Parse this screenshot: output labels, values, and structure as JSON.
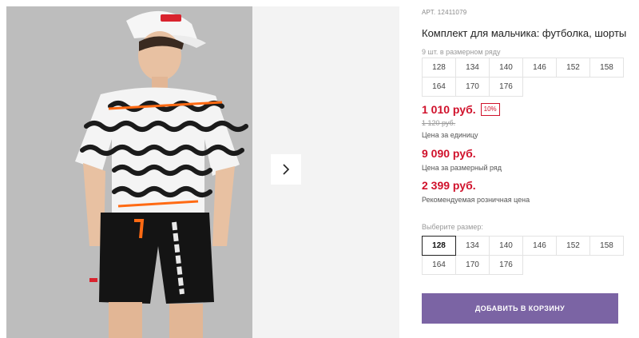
{
  "product": {
    "art_label": "АРТ.",
    "art_number": "12411079",
    "title": "Комплект для мальчика: футболка, шорты",
    "pack_note": "9 шт. в размерном ряду",
    "pack_sizes": [
      "128",
      "134",
      "140",
      "146",
      "152",
      "158",
      "164",
      "170",
      "176"
    ]
  },
  "pricing": {
    "unit_price": "1 010 руб.",
    "discount": "10%",
    "old_price": "1 120 руб.",
    "unit_caption": "Цена за единицу",
    "row_price": "9 090 руб.",
    "row_caption": "Цена за размерный ряд",
    "rrp_price": "2 399 руб.",
    "rrp_caption": "Рекомендуемая розничная цена"
  },
  "size_picker": {
    "label": "Выберите размер:",
    "options": [
      "128",
      "134",
      "140",
      "146",
      "152",
      "158",
      "164",
      "170",
      "176"
    ],
    "selected": "128"
  },
  "cart": {
    "button_label": "Добавить в корзину"
  },
  "gallery": {
    "next_icon": "chevron-right-icon",
    "photo_bg": "#bdbdbd"
  },
  "colors": {
    "price_red": "#d0112b",
    "cart_button": "#7b64a4"
  }
}
